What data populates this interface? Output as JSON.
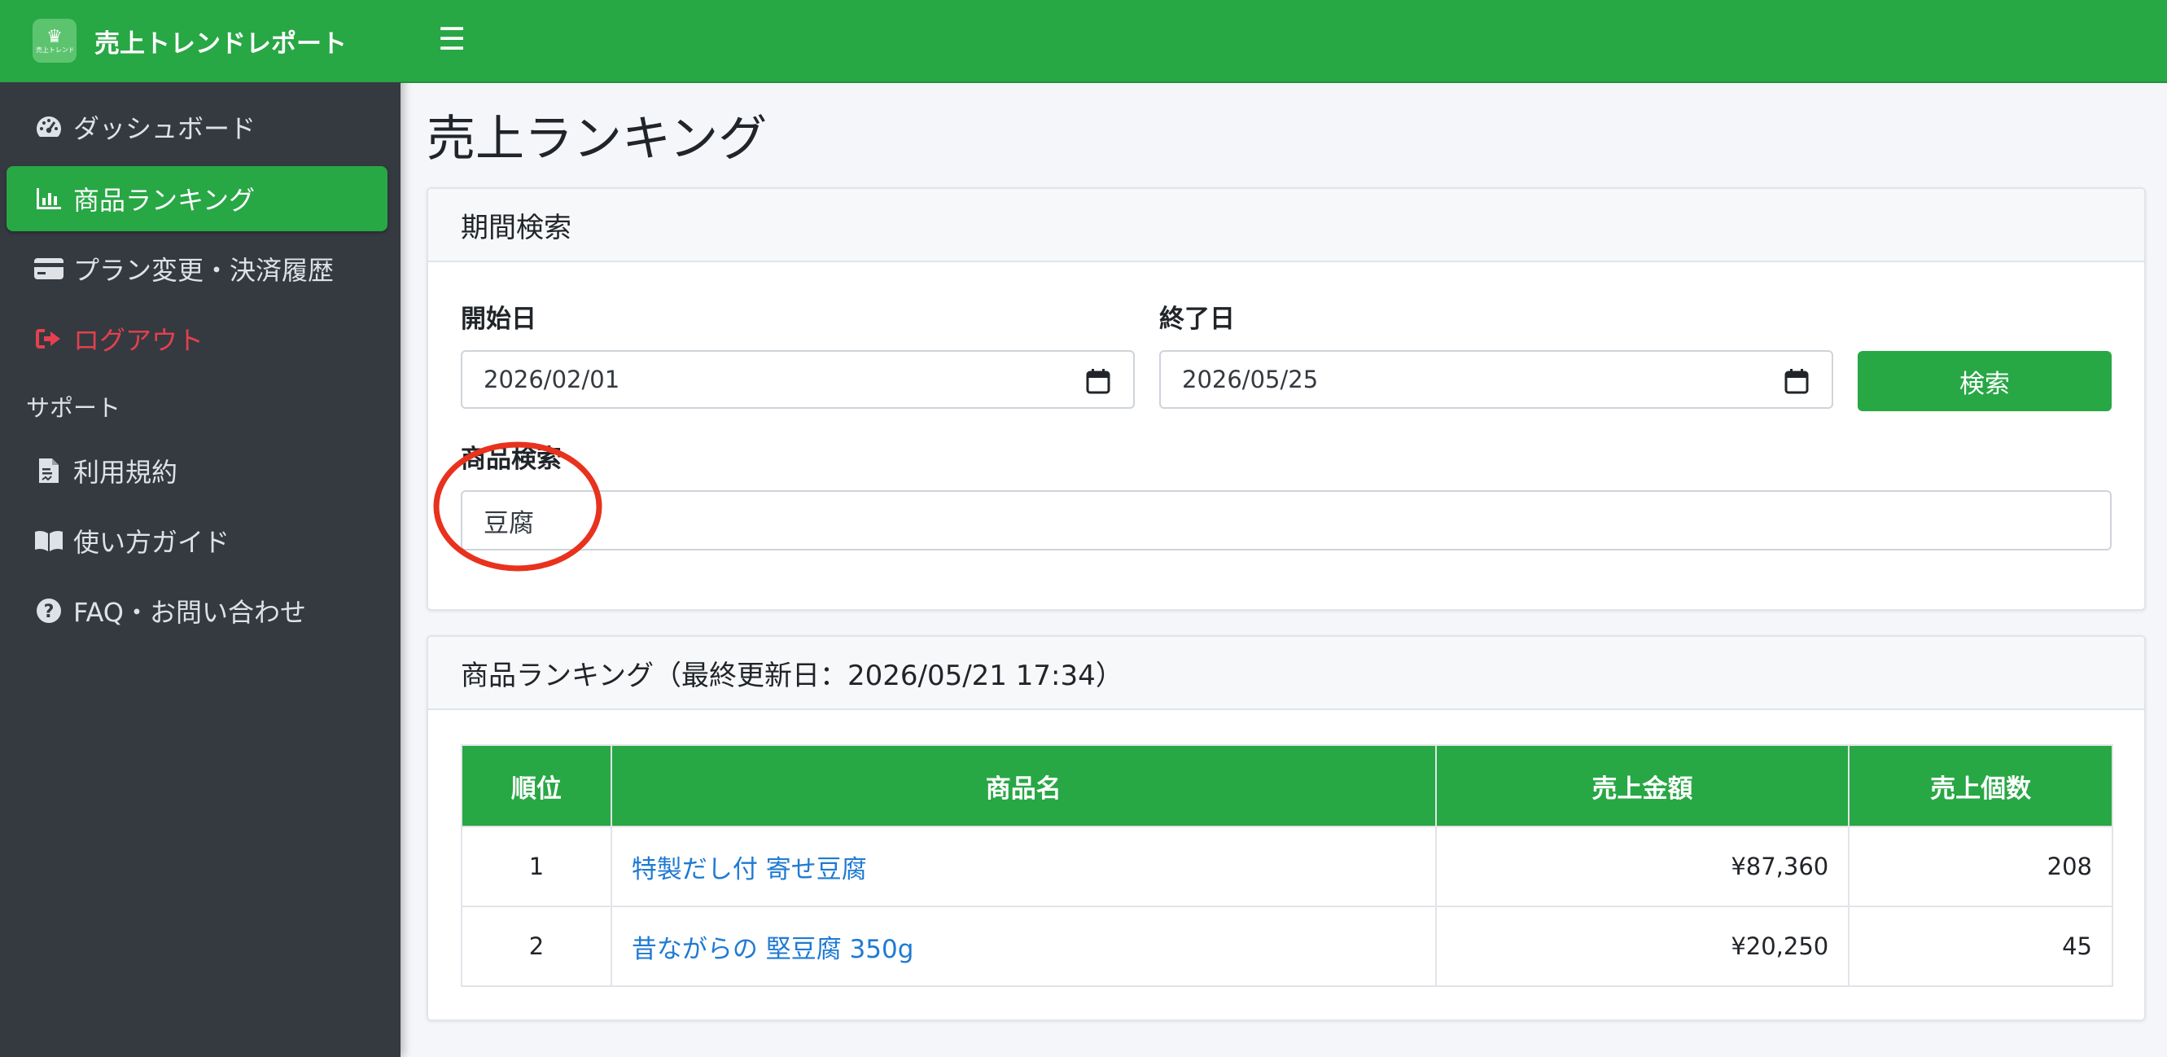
{
  "app": {
    "title": "売上トレンドレポート",
    "logo_text": "売上トレンドレポート"
  },
  "sidebar": {
    "items": [
      {
        "label": "ダッシュボード",
        "icon": "gauge-icon"
      },
      {
        "label": "商品ランキング",
        "icon": "bar-chart-icon",
        "active": true
      },
      {
        "label": "プラン変更・決済履歴",
        "icon": "credit-card-icon"
      },
      {
        "label": "ログアウト",
        "icon": "sign-out-icon"
      }
    ],
    "support_header": "サポート",
    "support_items": [
      {
        "label": "利用規約",
        "icon": "file-contract-icon"
      },
      {
        "label": "使い方ガイド",
        "icon": "book-icon"
      },
      {
        "label": "FAQ・お問い合わせ",
        "icon": "question-circle-icon"
      }
    ]
  },
  "topbar": {
    "menu_icon": "hamburger-icon"
  },
  "page": {
    "title": "売上ランキング"
  },
  "search_card": {
    "header": "期間検索",
    "start_label": "開始日",
    "start_value": "2026/02/01",
    "end_label": "終了日",
    "end_value": "2026/05/25",
    "button_label": "検索",
    "product_label": "商品検索",
    "product_value": "豆腐"
  },
  "ranking_card": {
    "header": "商品ランキング（最終更新日：2026/05/21 17:34）",
    "columns": [
      "順位",
      "商品名",
      "売上金額",
      "売上個数"
    ],
    "rows": [
      {
        "rank": "1",
        "name": "特製だし付 寄せ豆腐",
        "amount": "¥87,360",
        "qty": "208"
      },
      {
        "rank": "2",
        "name": "昔ながらの 堅豆腐 350g",
        "amount": "¥20,250",
        "qty": "45"
      }
    ]
  },
  "colors": {
    "primary": "#28a745",
    "sidebar": "#343a40",
    "danger": "#e4404f",
    "link": "#1f7ad3",
    "annotation": "#e8321e"
  }
}
